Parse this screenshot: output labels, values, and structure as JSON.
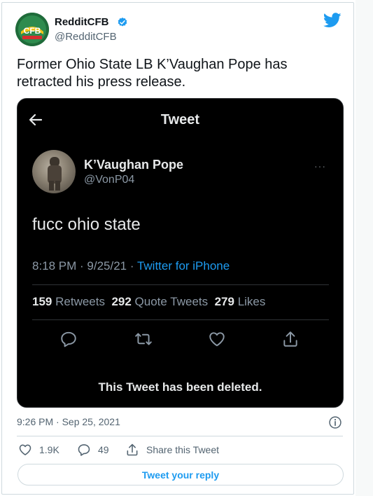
{
  "author": {
    "display_name": "RedditCFB",
    "handle": "@RedditCFB",
    "avatar_text": "CFB"
  },
  "tweet": {
    "text": "Former Ohio State LB K’Vaughan Pope has retracted his press release.",
    "timestamp": "9:26 PM · Sep 25, 2021",
    "likes": "1.9K",
    "replies": "49",
    "share_label": "Share this Tweet",
    "reply_label": "Tweet your reply"
  },
  "screenshot": {
    "header_title": "Tweet",
    "name": "K’Vaughan Pope",
    "handle": "@VonP04",
    "more": "···",
    "text": "fucc ohio state",
    "time": "8:18 PM · 9/25/21 · ",
    "source": "Twitter for iPhone",
    "retweets_count": "159",
    "retweets_label": "Retweets",
    "quotes_count": "292",
    "quotes_label": "Quote Tweets",
    "likes_count": "279",
    "likes_label": "Likes",
    "deleted_notice": "This Tweet has been deleted."
  },
  "colors": {
    "accent": "#1d9bf0",
    "avatar_green": "#1f6b3a",
    "embedded_bg": "#000000"
  },
  "icons": [
    "verified-badge-icon",
    "twitter-bird-icon",
    "back-arrow-icon",
    "reply-icon",
    "retweet-icon",
    "heart-icon",
    "share-icon",
    "info-icon"
  ]
}
